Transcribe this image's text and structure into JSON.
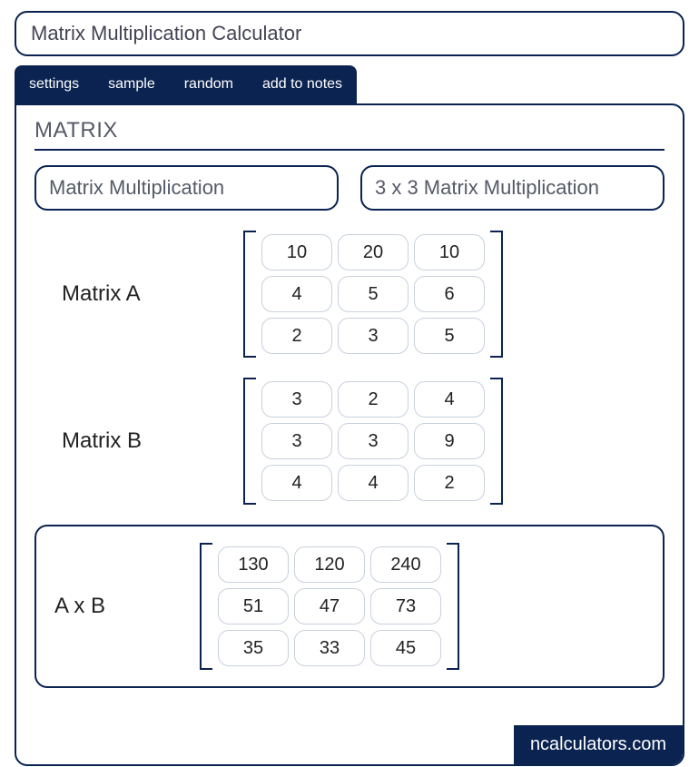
{
  "title": "Matrix Multiplication Calculator",
  "tabs": {
    "t0": "settings",
    "t1": "sample",
    "t2": "random",
    "t3": "add to notes"
  },
  "section": "MATRIX",
  "modes": {
    "m0": "Matrix Multiplication",
    "m1": "3 x 3 Matrix Multiplication"
  },
  "matrix_a": {
    "label": "Matrix A",
    "r0c0": "10",
    "r0c1": "20",
    "r0c2": "10",
    "r1c0": "4",
    "r1c1": "5",
    "r1c2": "6",
    "r2c0": "2",
    "r2c1": "3",
    "r2c2": "5"
  },
  "matrix_b": {
    "label": "Matrix B",
    "r0c0": "3",
    "r0c1": "2",
    "r0c2": "4",
    "r1c0": "3",
    "r1c1": "3",
    "r1c2": "9",
    "r2c0": "4",
    "r2c1": "4",
    "r2c2": "2"
  },
  "result": {
    "label": "A x B",
    "r0c0": "130",
    "r0c1": "120",
    "r0c2": "240",
    "r1c0": "51",
    "r1c1": "47",
    "r1c2": "73",
    "r2c0": "35",
    "r2c1": "33",
    "r2c2": "45"
  },
  "brand": "ncalculators.com"
}
